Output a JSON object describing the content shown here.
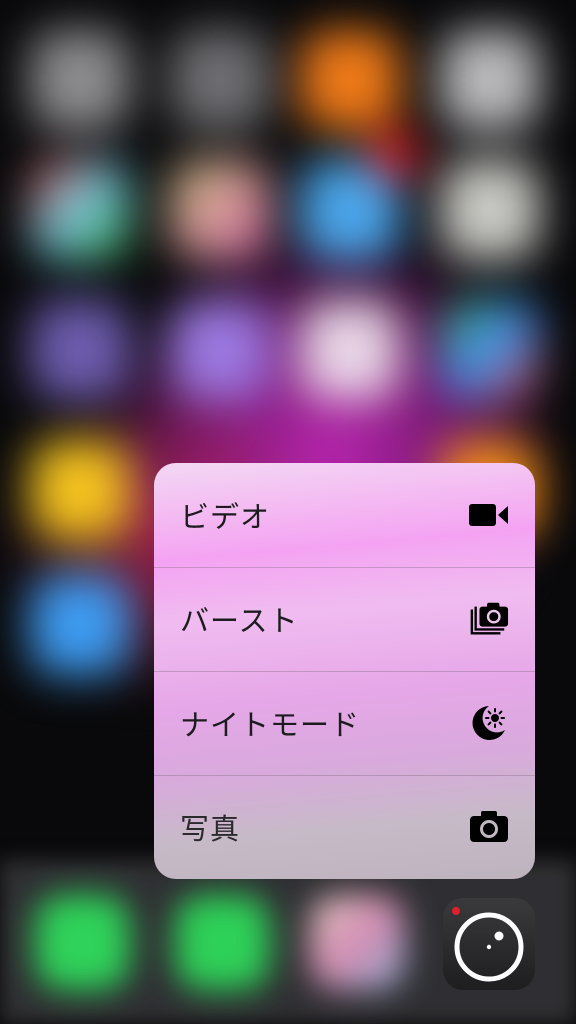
{
  "quick_actions": {
    "items": [
      {
        "label": "ビデオ",
        "icon": "video-camera-icon"
      },
      {
        "label": "バースト",
        "icon": "burst-camera-icon"
      },
      {
        "label": "ナイトモード",
        "icon": "night-mode-icon"
      },
      {
        "label": "写真",
        "icon": "camera-icon"
      }
    ]
  },
  "dock": {
    "app_icon": "camera-app-icon"
  },
  "colors": {
    "menu_gradient_top": "#f3d8f3",
    "menu_gradient_pink": "#f4a3f2",
    "menu_gradient_bottom": "#bdb3bd",
    "label_text": "#1c1c1e",
    "icon": "#000000",
    "app_icon_bg": "#2a2a2c",
    "app_icon_dot": "#e0202a"
  }
}
